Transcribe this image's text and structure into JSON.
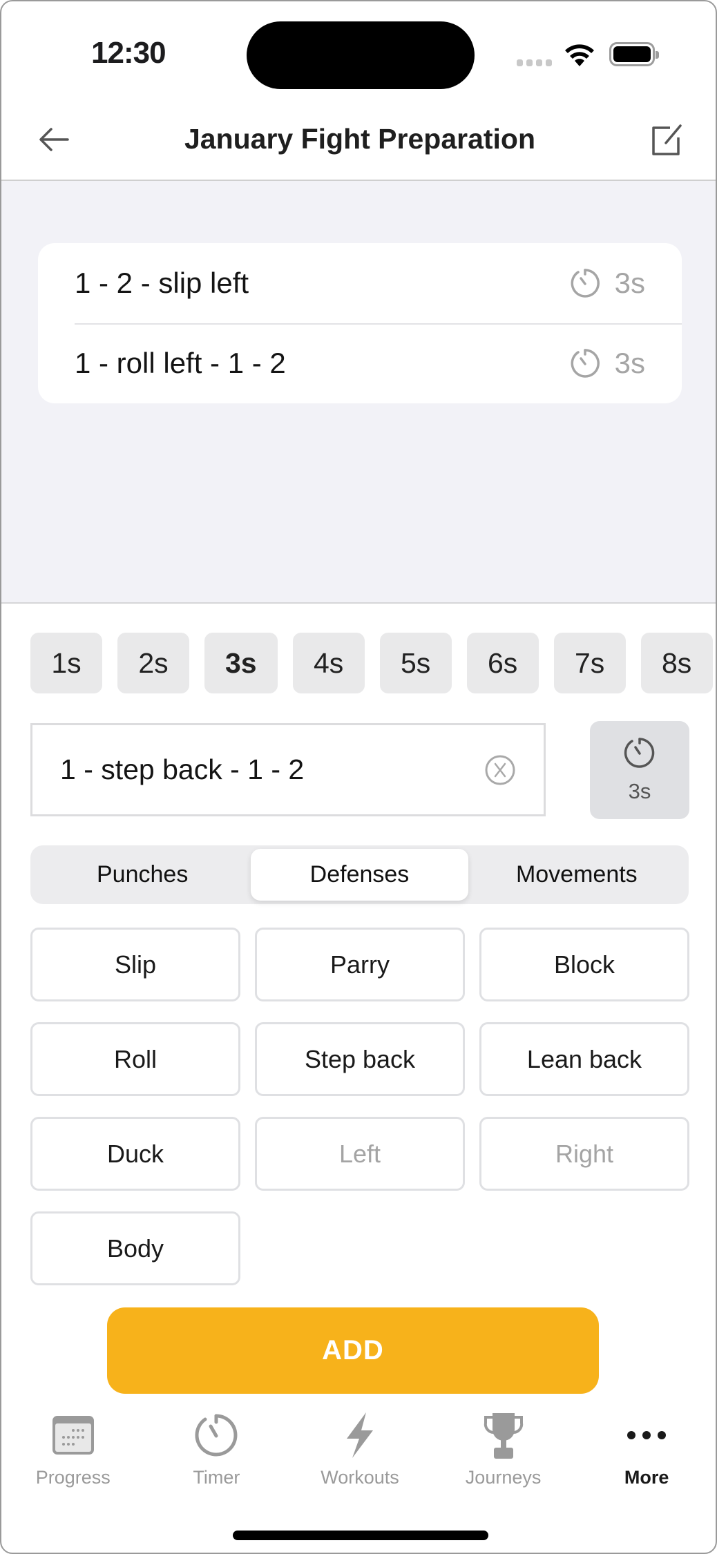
{
  "status_bar": {
    "time": "12:30"
  },
  "navbar": {
    "title": "January Fight Preparation"
  },
  "combos": [
    {
      "text": "1 - 2 - slip left",
      "duration": "3s"
    },
    {
      "text": "1 - roll left - 1 - 2",
      "duration": "3s"
    }
  ],
  "durations": {
    "options": [
      "1s",
      "2s",
      "3s",
      "4s",
      "5s",
      "6s",
      "7s",
      "8s"
    ],
    "selected": "3s"
  },
  "combo_input": {
    "value": "1 - step back - 1 - 2",
    "duration": "3s"
  },
  "categories": {
    "tabs": [
      "Punches",
      "Defenses",
      "Movements"
    ],
    "selected": "Defenses"
  },
  "moves": [
    {
      "label": "Slip",
      "enabled": true
    },
    {
      "label": "Parry",
      "enabled": true
    },
    {
      "label": "Block",
      "enabled": true
    },
    {
      "label": "Roll",
      "enabled": true
    },
    {
      "label": "Step back",
      "enabled": true
    },
    {
      "label": "Lean back",
      "enabled": true
    },
    {
      "label": "Duck",
      "enabled": true
    },
    {
      "label": "Left",
      "enabled": false
    },
    {
      "label": "Right",
      "enabled": false
    },
    {
      "label": "Body",
      "enabled": true
    }
  ],
  "add_button": {
    "label": "ADD",
    "color": "#f7b21b"
  },
  "tabbar": {
    "items": [
      {
        "label": "Progress",
        "icon": "calendar-icon",
        "active": false
      },
      {
        "label": "Timer",
        "icon": "timer-icon",
        "active": false
      },
      {
        "label": "Workouts",
        "icon": "bolt-icon",
        "active": false
      },
      {
        "label": "Journeys",
        "icon": "trophy-icon",
        "active": false
      },
      {
        "label": "More",
        "icon": "more-icon",
        "active": true
      }
    ]
  }
}
